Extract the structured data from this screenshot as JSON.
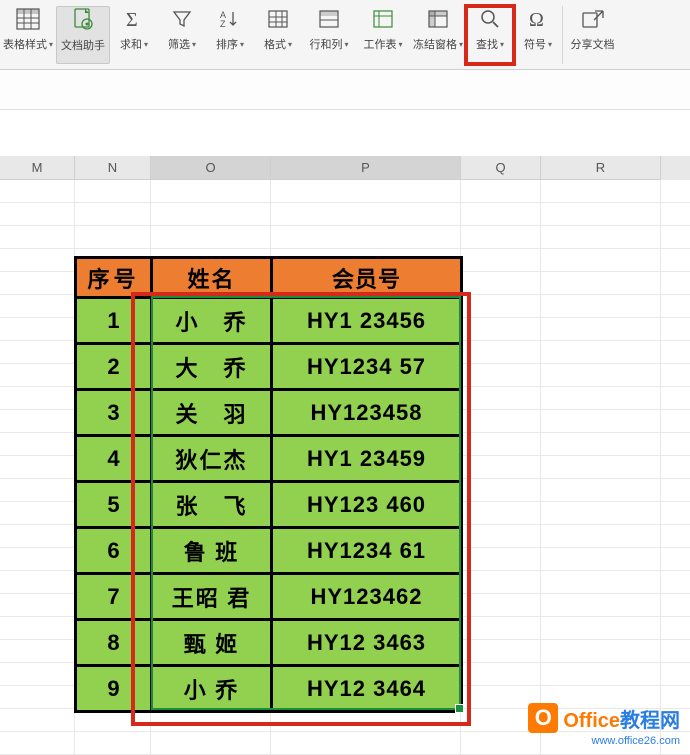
{
  "toolbar": {
    "items": [
      {
        "label": "表格样式",
        "has_caret": true,
        "icon": "table-style-icon"
      },
      {
        "label": "文档助手",
        "has_caret": false,
        "icon": "doc-assistant-icon",
        "active": true
      },
      {
        "label": "求和",
        "has_caret": true,
        "icon": "sum-icon"
      },
      {
        "label": "筛选",
        "has_caret": true,
        "icon": "filter-icon"
      },
      {
        "label": "排序",
        "has_caret": true,
        "icon": "sort-icon"
      },
      {
        "label": "格式",
        "has_caret": true,
        "icon": "format-icon"
      },
      {
        "label": "行和列",
        "has_caret": true,
        "icon": "rows-cols-icon"
      },
      {
        "label": "工作表",
        "has_caret": true,
        "icon": "worksheet-icon"
      },
      {
        "label": "冻结窗格",
        "has_caret": true,
        "icon": "freeze-panes-icon"
      },
      {
        "label": "查找",
        "has_caret": true,
        "icon": "find-icon",
        "highlight": true
      },
      {
        "label": "符号",
        "has_caret": true,
        "icon": "symbol-icon"
      },
      {
        "label": "分享文档",
        "has_caret": false,
        "icon": "share-icon"
      }
    ]
  },
  "columns": [
    "M",
    "N",
    "O",
    "P",
    "Q",
    "R"
  ],
  "selected_columns": [
    "O",
    "P"
  ],
  "table": {
    "headers": [
      "序号",
      "姓名",
      "会员号"
    ],
    "rows": [
      {
        "no": "1",
        "name": "小　乔",
        "code": "HY1 23456"
      },
      {
        "no": "2",
        "name": "大　乔",
        "code": "HY1234 57"
      },
      {
        "no": "3",
        "name": "关　羽",
        "code": "HY123458"
      },
      {
        "no": "4",
        "name": "狄仁杰",
        "code": "HY1 23459"
      },
      {
        "no": "5",
        "name": "张　飞",
        "code": "HY123 460"
      },
      {
        "no": "6",
        "name": "鲁 班",
        "code": "HY1234 61"
      },
      {
        "no": "7",
        "name": "王昭 君",
        "code": "HY123462"
      },
      {
        "no": "8",
        "name": "甄 姬",
        "code": "HY12 3463"
      },
      {
        "no": "9",
        "name": "小 乔",
        "code": "HY12 3464"
      }
    ]
  },
  "watermark": {
    "brand1": "Office",
    "brand2": "教程网",
    "url": "www.office26.com"
  },
  "chart_data": {
    "type": "table",
    "title": "",
    "columns": [
      "序号",
      "姓名",
      "会员号"
    ],
    "rows": [
      [
        "1",
        "小 乔",
        "HY1 23456"
      ],
      [
        "2",
        "大 乔",
        "HY1234 57"
      ],
      [
        "3",
        "关 羽",
        "HY123458"
      ],
      [
        "4",
        "狄仁杰",
        "HY1 23459"
      ],
      [
        "5",
        "张 飞",
        "HY123 460"
      ],
      [
        "6",
        "鲁 班",
        "HY1234 61"
      ],
      [
        "7",
        "王昭 君",
        "HY123462"
      ],
      [
        "8",
        "甄 姬",
        "HY12 3463"
      ],
      [
        "9",
        "小 乔",
        "HY12 3464"
      ]
    ]
  }
}
